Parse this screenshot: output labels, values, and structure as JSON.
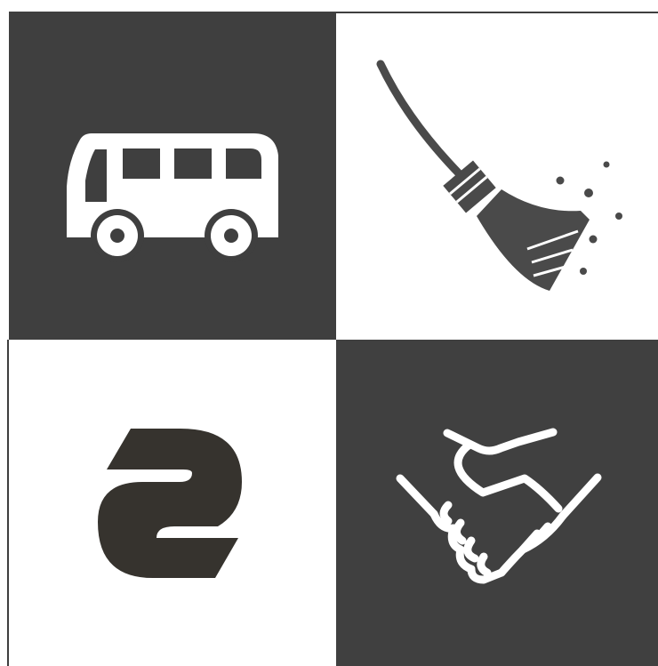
{
  "tiles": [
    {
      "icon": "bus-icon",
      "background": "#3f3f3f",
      "foreground": "#ffffff"
    },
    {
      "icon": "broom-icon",
      "background": "#ffffff",
      "foreground": "#4a4a4a"
    },
    {
      "icon": "logo-icon",
      "background": "#ffffff",
      "foreground": "#36332e"
    },
    {
      "icon": "handshake-icon",
      "background": "#404040",
      "foreground": "#ffffff"
    }
  ]
}
